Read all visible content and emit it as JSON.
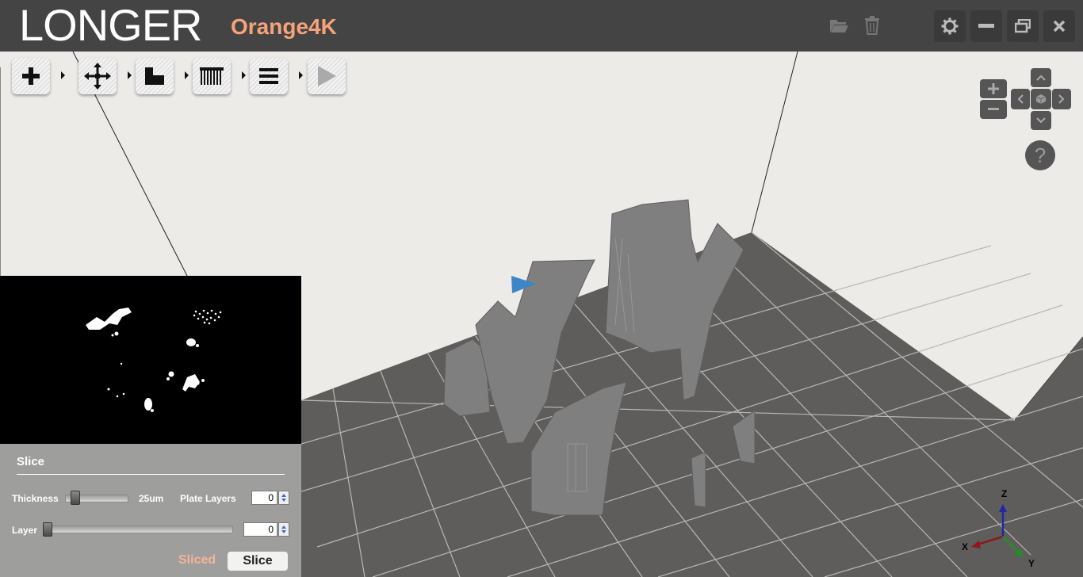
{
  "app": {
    "brand": "LONGER",
    "model": "Orange4K"
  },
  "titlebar": {
    "icons": [
      "folder-open-icon",
      "trash-icon"
    ],
    "window_buttons": [
      "gear-icon",
      "minimize-icon",
      "restore-icon",
      "close-icon"
    ]
  },
  "toolbar": {
    "buttons": [
      "add-icon",
      "move-icon",
      "support-icon",
      "slice-layers-icon",
      "menu-icon",
      "play-icon"
    ]
  },
  "navigation": {
    "zoom": [
      "zoom-in-icon",
      "zoom-out-icon"
    ],
    "view": [
      "chevron-up-icon",
      "chevron-left-icon",
      "cube-icon",
      "chevron-right-icon",
      "chevron-down-icon"
    ],
    "help": "?"
  },
  "axes": {
    "z": "Z",
    "x": "X",
    "y": "Y"
  },
  "slice_panel": {
    "title": "Slice",
    "thickness_label": "Thickness",
    "thickness_value": "25um",
    "thickness_slider_fraction": 0.1,
    "plate_layers_label": "Plate Layers",
    "plate_layers_value": "0",
    "layer_label": "Layer",
    "layer_value": "0",
    "layer_slider_fraction": 0.0,
    "sliced_label": "Sliced",
    "slice_button": "Slice"
  },
  "colors": {
    "titlebar": "#444444",
    "accent": "#f6a37a",
    "platform": "#5f5d5b",
    "model": "#7f7f7f",
    "background": "#ecebe8"
  }
}
